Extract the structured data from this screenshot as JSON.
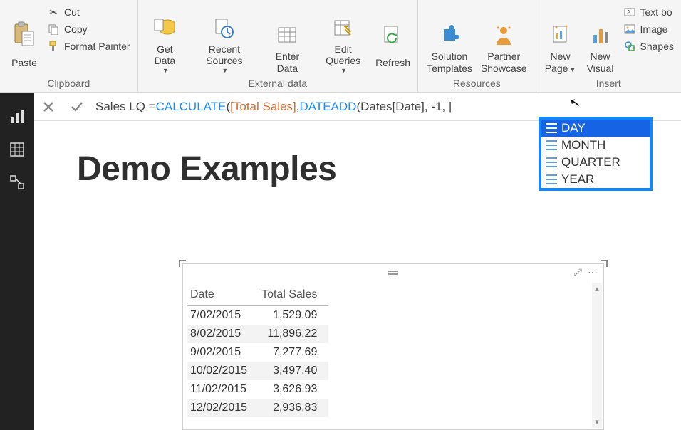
{
  "ribbon": {
    "clipboard": {
      "label": "Clipboard",
      "paste": "Paste",
      "cut": "Cut",
      "copy": "Copy",
      "format_painter": "Format Painter"
    },
    "external": {
      "label": "External data",
      "get_data": "Get Data",
      "recent_sources": "Recent Sources",
      "enter_data": "Enter Data",
      "edit_queries": "Edit Queries",
      "refresh": "Refresh"
    },
    "resources": {
      "label": "Resources",
      "solution_templates_l1": "Solution",
      "solution_templates_l2": "Templates",
      "partner_l1": "Partner",
      "partner_l2": "Showcase"
    },
    "insert": {
      "label": "Insert",
      "new_page_l1": "New",
      "new_page_l2": "Page",
      "new_visual_l1": "New",
      "new_visual_l2": "Visual",
      "text_box": "Text bo",
      "image": "Image",
      "shapes": "Shapes"
    }
  },
  "formula": {
    "lhs": "Sales LQ = ",
    "fn1": "CALCULATE",
    "open1": "( ",
    "col1": "[Total Sales]",
    "sep1": ", ",
    "fn2": "DATEADD",
    "open2": "( ",
    "col2": "Dates[Date]",
    "tail": ", -1, |"
  },
  "autocomplete": {
    "items": [
      "DAY",
      "MONTH",
      "QUARTER",
      "YEAR"
    ],
    "selected_index": 0
  },
  "page": {
    "title": "Demo Examples"
  },
  "table": {
    "columns": [
      "Date",
      "Total Sales"
    ],
    "rows": [
      {
        "date": "7/02/2015",
        "value": "1,529.09"
      },
      {
        "date": "8/02/2015",
        "value": "11,896.22"
      },
      {
        "date": "9/02/2015",
        "value": "7,277.69"
      },
      {
        "date": "10/02/2015",
        "value": "3,497.40"
      },
      {
        "date": "11/02/2015",
        "value": "3,626.93"
      },
      {
        "date": "12/02/2015",
        "value": "2,936.83"
      }
    ]
  }
}
